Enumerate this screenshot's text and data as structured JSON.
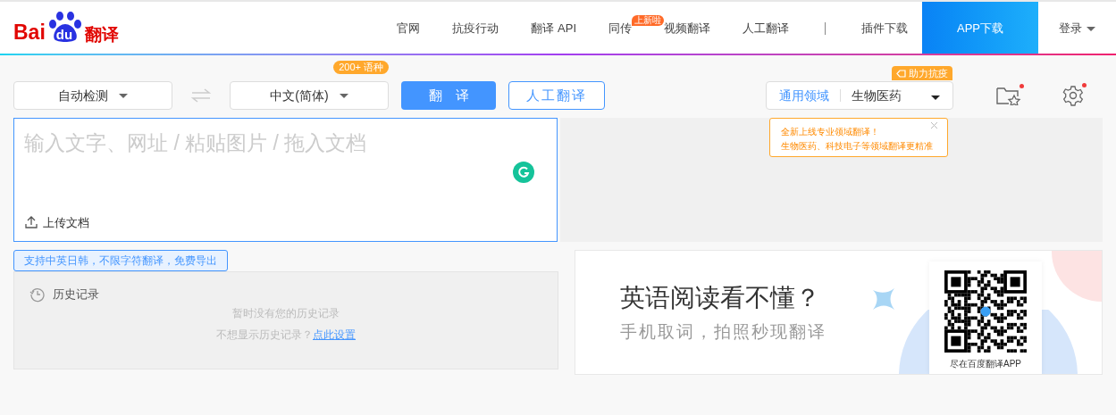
{
  "logo": {
    "brand": "Bai",
    "mark": "du",
    "product": "翻译"
  },
  "nav": [
    {
      "label": "官网",
      "kind": "link"
    },
    {
      "label": "抗疫行动",
      "kind": "link"
    },
    {
      "label": "翻译 API",
      "kind": "link"
    },
    {
      "label": "同传",
      "kind": "link",
      "badge": "上新啦"
    },
    {
      "label": "视频翻译",
      "kind": "link"
    },
    {
      "label": "人工翻译",
      "kind": "link"
    },
    {
      "label": "插件下载",
      "kind": "link",
      "divider_before": true
    },
    {
      "label": "APP下载",
      "kind": "highlight"
    },
    {
      "label": "登录",
      "kind": "dropdown"
    }
  ],
  "toolbar": {
    "source_lang": "自动检测",
    "target_lang": "中文(简体)",
    "target_badge": "200+ 语种",
    "translate_button": "翻　译",
    "human_button": "人工翻译"
  },
  "domain": {
    "general": "通用领域",
    "selected": "生物医药",
    "badge": "助力抗疫"
  },
  "toolbar_icons": [
    {
      "kind": "favorites",
      "dot": true
    },
    {
      "kind": "settings",
      "dot": true
    }
  ],
  "popup": {
    "lines": [
      "全新上线专业领域翻译！",
      "生物医药、科技电子等领域翻译更精准"
    ]
  },
  "input": {
    "placeholder": "输入文字、网址 / 粘贴图片 / 拖入文档",
    "upload": "上传文档"
  },
  "hint": "支持中英日韩，不限字符翻译，免费导出",
  "history": {
    "title": "历史记录",
    "empty": "暂时没有您的历史记录",
    "prompt": "不想显示历史记录？",
    "link": "点此设置"
  },
  "promo": {
    "headline": "英语阅读看不懂？",
    "subline": "手机取词，拍照秒现翻译",
    "qr_caption": "尽在百度翻译APP"
  }
}
